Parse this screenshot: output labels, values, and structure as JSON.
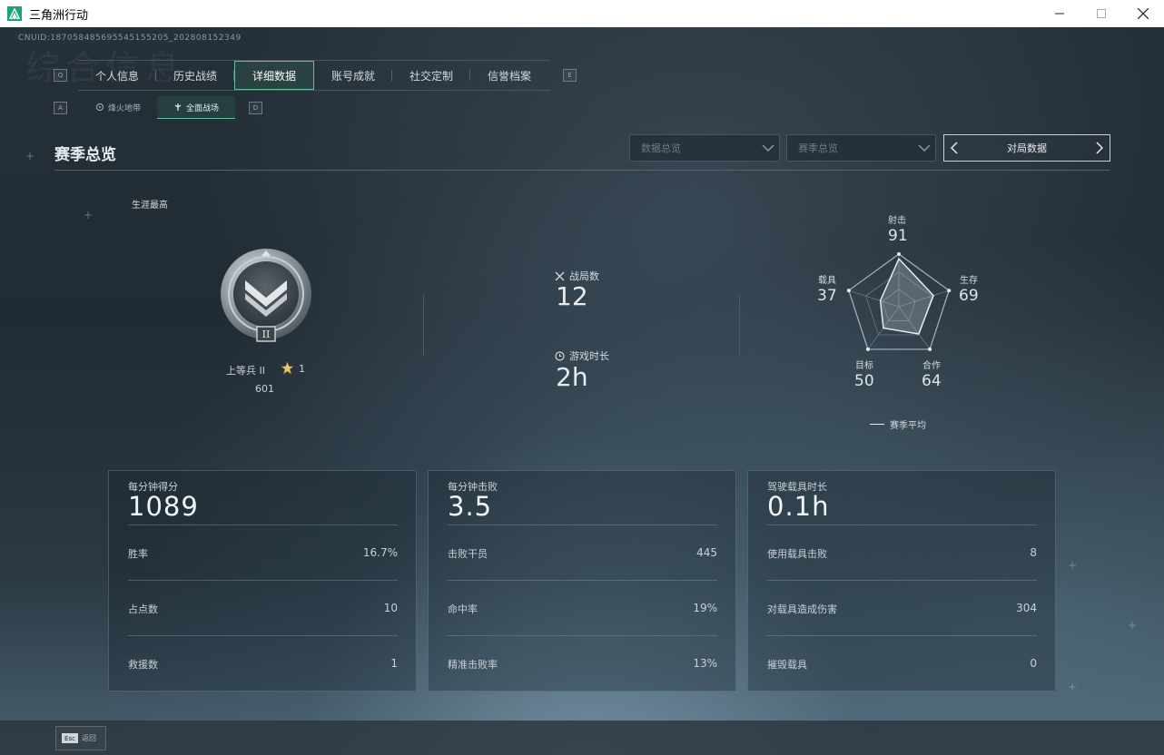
{
  "window": {
    "title": "三角洲行动"
  },
  "header": {
    "uid": "CNUID:187058485695545155205_202808152349",
    "bg_title": "综合信息",
    "key_q": "Q",
    "key_e": "E",
    "key_a": "A",
    "key_d": "D"
  },
  "nav": {
    "tabs": [
      {
        "label": "个人信息"
      },
      {
        "label": "历史战绩"
      },
      {
        "label": "详细数据"
      },
      {
        "label": "账号成就"
      },
      {
        "label": "社交定制"
      },
      {
        "label": "信誉档案"
      }
    ],
    "active_tab": "详细数据",
    "subtabs": [
      {
        "label": "烽火地带"
      },
      {
        "label": "全面战场"
      }
    ],
    "active_subtab": "全面战场"
  },
  "section": {
    "title": "赛季总览"
  },
  "filters": {
    "data_overview": "数据总览",
    "season_overview": "赛季总览",
    "match_data": "对局数据"
  },
  "career": {
    "label": "生涯最高",
    "rank_name": "上等兵 II",
    "rank_emblem_numeral": "II",
    "stars": "1",
    "score": "601"
  },
  "stats": {
    "matches_label": "战局数",
    "matches_value": "12",
    "playtime_label": "游戏时长",
    "playtime_value": "2h"
  },
  "radar": {
    "axes": [
      {
        "label": "射击",
        "value": "91"
      },
      {
        "label": "生存",
        "value": "69"
      },
      {
        "label": "合作",
        "value": "64"
      },
      {
        "label": "目标",
        "value": "50"
      },
      {
        "label": "载具",
        "value": "37"
      }
    ],
    "values_numeric": [
      91,
      69,
      64,
      50,
      37
    ],
    "max": 100,
    "legend": "赛季平均"
  },
  "cards": [
    {
      "title": "每分钟得分",
      "value": "1089",
      "rows": [
        {
          "label": "胜率",
          "value": "16.7%"
        },
        {
          "label": "占点数",
          "value": "10"
        },
        {
          "label": "救援数",
          "value": "1"
        }
      ]
    },
    {
      "title": "每分钟击败",
      "value": "3.5",
      "rows": [
        {
          "label": "击败干员",
          "value": "445"
        },
        {
          "label": "命中率",
          "value": "19%"
        },
        {
          "label": "精准击败率",
          "value": "13%"
        }
      ]
    },
    {
      "title": "驾驶载具时长",
      "value": "0.1h",
      "rows": [
        {
          "label": "使用载具击败",
          "value": "8"
        },
        {
          "label": "对载具造成伤害",
          "value": "304"
        },
        {
          "label": "摧毁载具",
          "value": "0"
        }
      ]
    }
  ],
  "footer": {
    "esc_key": "Esc",
    "esc_label": "返回"
  },
  "colors": {
    "accent": "#5fbf9e",
    "star": "#e9c46a",
    "panel_border": "#4a5560"
  }
}
